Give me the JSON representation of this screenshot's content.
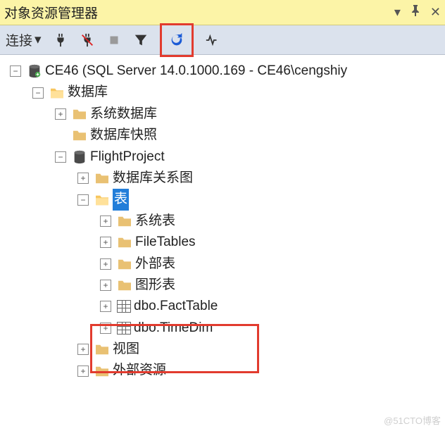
{
  "titlebar": {
    "title": "对象资源管理器"
  },
  "toolbar": {
    "connect_label": "连接"
  },
  "tree": {
    "server": "CE46 (SQL Server 14.0.1000.169 - CE46\\cengshiy",
    "databases": "数据库",
    "sys_db": "系统数据库",
    "snapshot": "数据库快照",
    "project": "FlightProject",
    "diagrams": "数据库关系图",
    "tables": "表",
    "sys_tables": "系统表",
    "filetables": "FileTables",
    "external_tables": "外部表",
    "graph_tables": "图形表",
    "fact": "dbo.FactTable",
    "timedim": "dbo.TimeDim",
    "views": "视图",
    "external_res": "外部资源"
  },
  "watermark": "@51CTO博客"
}
